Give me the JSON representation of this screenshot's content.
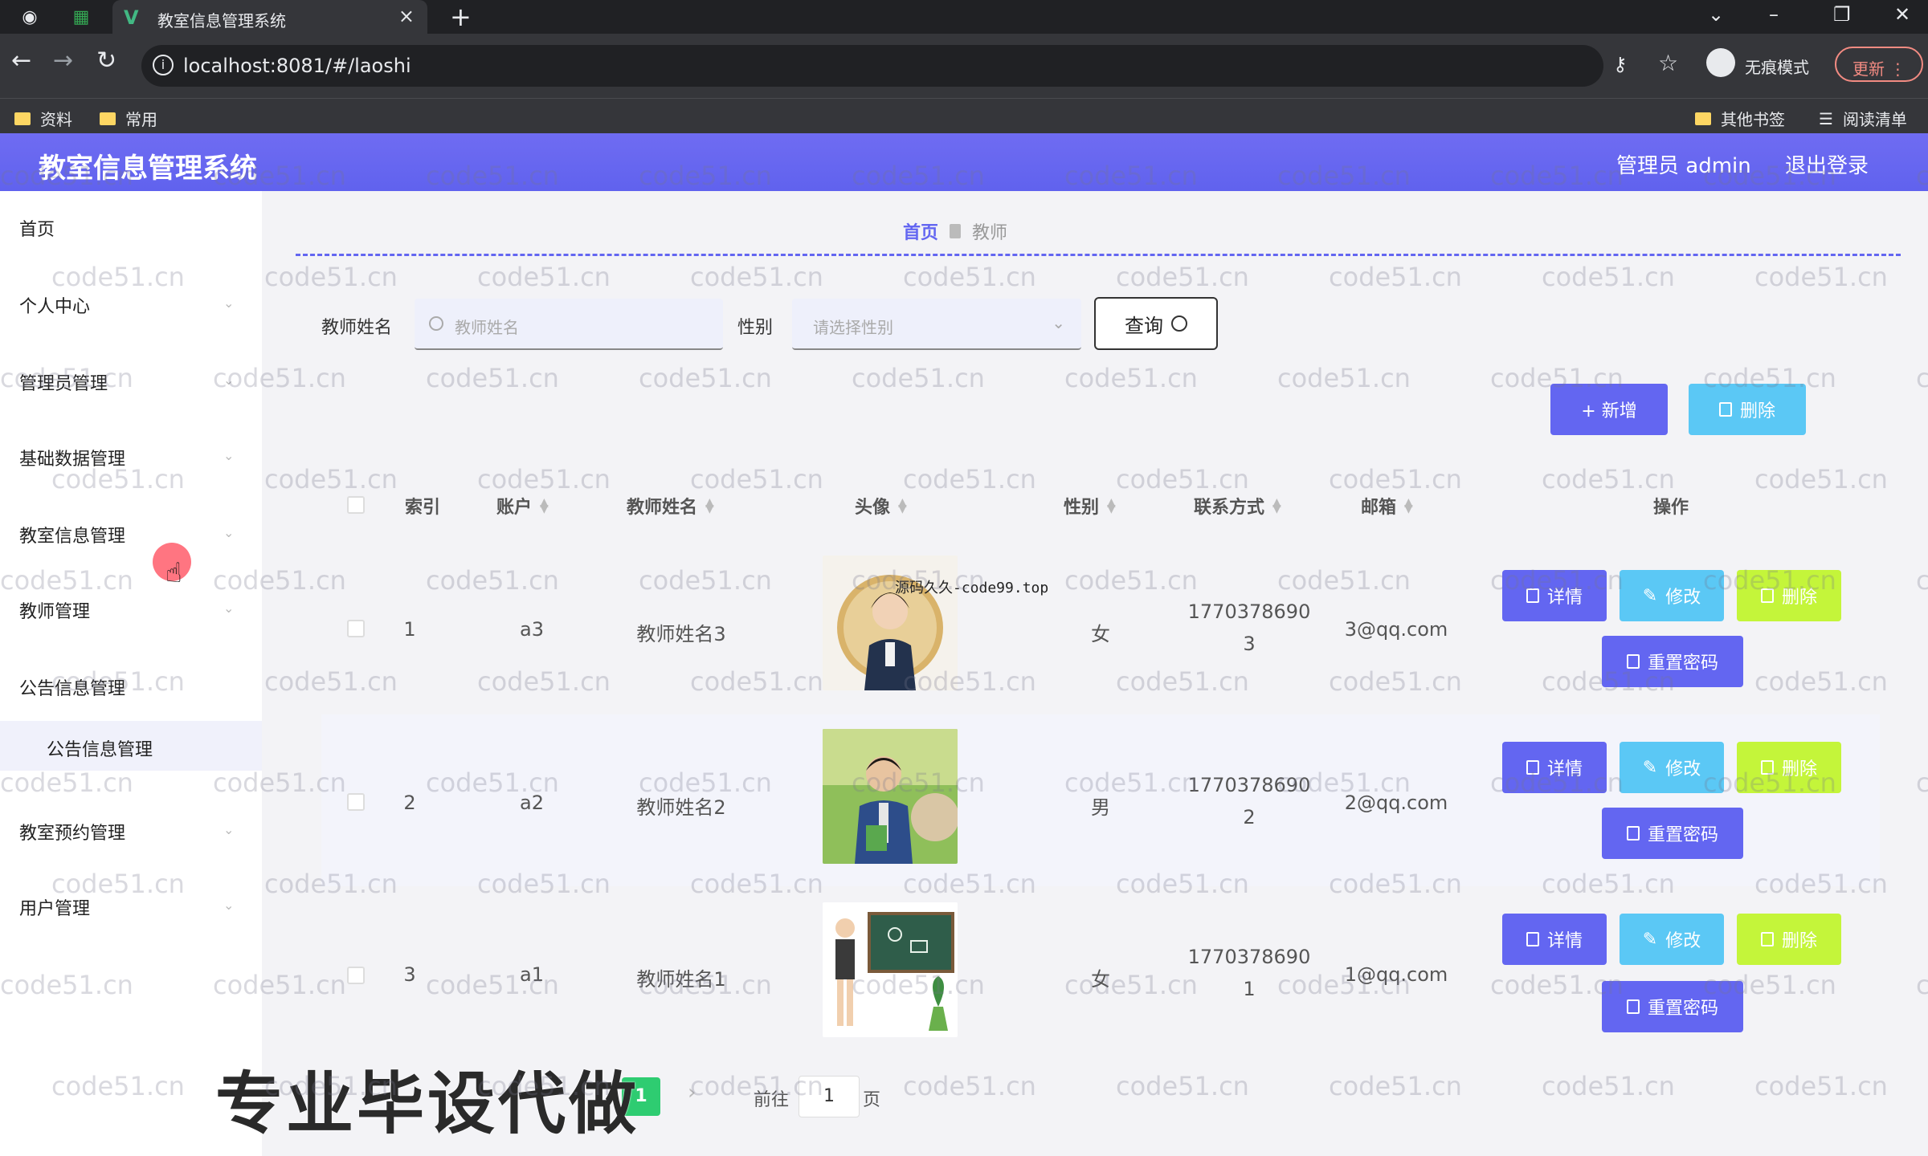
{
  "browser": {
    "tab_title": "教室信息管理系统",
    "url": "localhost:8081/#/laoshi",
    "incognito_label": "无痕模式",
    "update_label": "更新",
    "bookmarks": [
      "资料",
      "常用"
    ],
    "bookmarks_right": [
      "其他书签",
      "阅读清单"
    ]
  },
  "app": {
    "title": "教室信息管理系统",
    "admin_label": "管理员 admin",
    "logout_label": "退出登录"
  },
  "sidebar": {
    "items": [
      "首页",
      "个人中心",
      "管理员管理",
      "基础数据管理",
      "教室信息管理",
      "教师管理",
      "公告信息管理",
      "教室预约管理",
      "用户管理"
    ],
    "sub_item": "公告信息管理"
  },
  "breadcrumb": {
    "home": "首页",
    "current": "教师"
  },
  "filters": {
    "name_label": "教师姓名",
    "name_placeholder": "教师姓名",
    "gender_label": "性别",
    "gender_placeholder": "请选择性别",
    "query_label": "查询"
  },
  "actions": {
    "add_label": "+ 新增",
    "delete_label": "删除"
  },
  "table": {
    "headers": [
      "索引",
      "账户",
      "教师姓名",
      "头像",
      "性别",
      "联系方式",
      "邮箱",
      "操作"
    ],
    "row_actions": {
      "detail": "详情",
      "edit": "修改",
      "delete": "删除",
      "reset": "重置密码"
    },
    "rows": [
      {
        "index": "1",
        "account": "a3",
        "name": "教师姓名3",
        "gender": "女",
        "phone_line1": "1770378690",
        "phone_line2": "3",
        "email": "3@qq.com"
      },
      {
        "index": "2",
        "account": "a2",
        "name": "教师姓名2",
        "gender": "男",
        "phone_line1": "1770378690",
        "phone_line2": "2",
        "email": "2@qq.com"
      },
      {
        "index": "3",
        "account": "a1",
        "name": "教师姓名1",
        "gender": "女",
        "phone_line1": "1770378690",
        "phone_line2": "1",
        "email": "1@qq.com"
      }
    ]
  },
  "pagination": {
    "current_page": "1",
    "goto_label": "前往",
    "goto_value": "1",
    "page_suffix": "页"
  },
  "overlays": {
    "promo_text": "专业毕设代做",
    "source_watermark": "源码久久-code99.top",
    "watermark": "code51.cn"
  },
  "colors": {
    "primary": "#6366f1",
    "cyan": "#5bc8f5",
    "lime": "#c4f53a",
    "pager": "#2ecc71"
  }
}
